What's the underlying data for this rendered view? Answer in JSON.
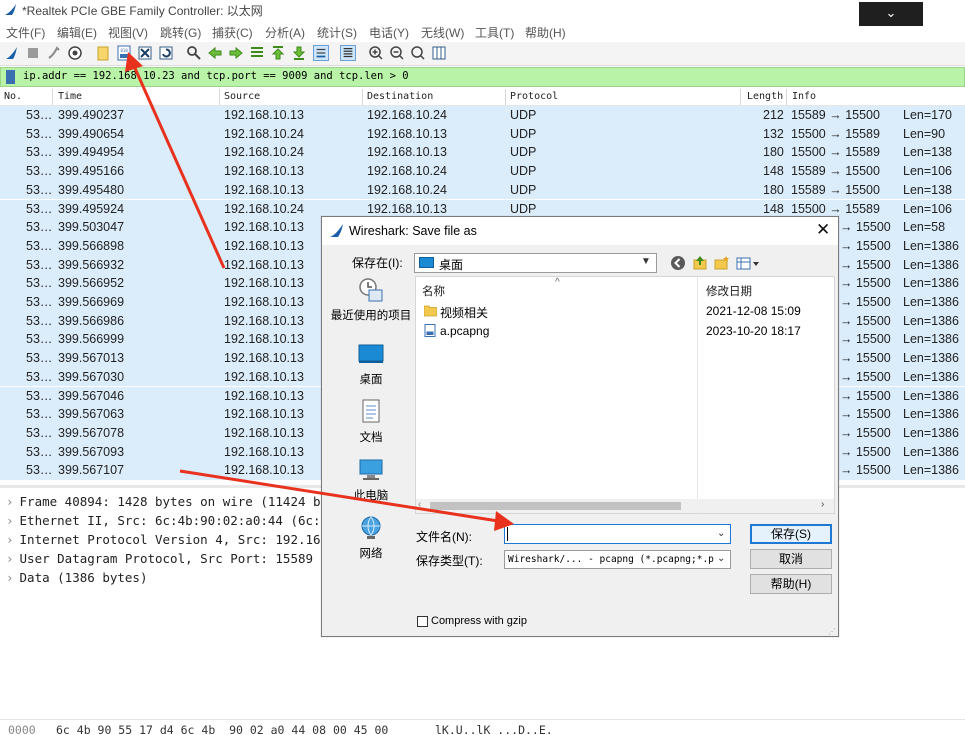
{
  "window": {
    "title": "*Realtek PCIe GBE Family Controller: 以太网",
    "minimize_glyph": "⌄"
  },
  "menu": [
    "文件(F)",
    "编辑(E)",
    "视图(V)",
    "跳转(G)",
    "捕获(C)",
    "分析(A)",
    "统计(S)",
    "电话(Y)",
    "无线(W)",
    "工具(T)",
    "帮助(H)"
  ],
  "toolbar": {
    "icons": [
      "shark-fin-start-icon",
      "stop-capture-icon",
      "restart-capture-icon",
      "capture-options-icon",
      "open-file-icon",
      "save-file-icon",
      "close-file-icon",
      "reload-file-icon",
      "find-packet-icon",
      "go-back-icon",
      "go-forward-icon",
      "go-to-packet-icon",
      "go-first-icon",
      "go-last-icon",
      "auto-scroll-icon",
      "colorize-icon",
      "zoom-in-icon",
      "zoom-out-icon",
      "zoom-normal-icon",
      "resize-columns-icon"
    ]
  },
  "filter": {
    "text": "ip.addr == 192.168.10.23 and tcp.port == 9009 and tcp.len > 0"
  },
  "columns": [
    "No.",
    "Time",
    "Source",
    "Destination",
    "Protocol",
    "Length",
    "Info"
  ],
  "packets": [
    {
      "no": "53…",
      "time": "399.490237",
      "src": "192.168.10.13",
      "dst": "192.168.10.24",
      "proto": "UDP",
      "len": "212",
      "info": "15589 → 15500",
      "extra": "Len=170"
    },
    {
      "no": "53…",
      "time": "399.490654",
      "src": "192.168.10.24",
      "dst": "192.168.10.13",
      "proto": "UDP",
      "len": "132",
      "info": "15500 → 15589",
      "extra": "Len=90"
    },
    {
      "no": "53…",
      "time": "399.494954",
      "src": "192.168.10.24",
      "dst": "192.168.10.13",
      "proto": "UDP",
      "len": "180",
      "info": "15500 → 15589",
      "extra": "Len=138"
    },
    {
      "no": "53…",
      "time": "399.495166",
      "src": "192.168.10.13",
      "dst": "192.168.10.24",
      "proto": "UDP",
      "len": "148",
      "info": "15589 → 15500",
      "extra": "Len=106"
    },
    {
      "no": "53…",
      "time": "399.495480",
      "src": "192.168.10.13",
      "dst": "192.168.10.24",
      "proto": "UDP",
      "len": "180",
      "info": "15589 → 15500",
      "extra": "Len=138"
    },
    {
      "no": "53…",
      "time": "399.495924",
      "src": "192.168.10.24",
      "dst": "192.168.10.13",
      "proto": "UDP",
      "len": "148",
      "info": "15500 → 15589",
      "extra": "Len=106"
    },
    {
      "no": "53…",
      "time": "399.503047",
      "src": "192.168.10.13",
      "dst": "",
      "proto": "",
      "len": "",
      "info": "→ 15500",
      "extra": "Len=58"
    },
    {
      "no": "53…",
      "time": "399.566898",
      "src": "192.168.10.13",
      "dst": "",
      "proto": "",
      "len": "",
      "info": "→ 15500",
      "extra": "Len=1386"
    },
    {
      "no": "53…",
      "time": "399.566932",
      "src": "192.168.10.13",
      "dst": "",
      "proto": "",
      "len": "",
      "info": "→ 15500",
      "extra": "Len=1386"
    },
    {
      "no": "53…",
      "time": "399.566952",
      "src": "192.168.10.13",
      "dst": "",
      "proto": "",
      "len": "",
      "info": "→ 15500",
      "extra": "Len=1386"
    },
    {
      "no": "53…",
      "time": "399.566969",
      "src": "192.168.10.13",
      "dst": "",
      "proto": "",
      "len": "",
      "info": "→ 15500",
      "extra": "Len=1386"
    },
    {
      "no": "53…",
      "time": "399.566986",
      "src": "192.168.10.13",
      "dst": "",
      "proto": "",
      "len": "",
      "info": "→ 15500",
      "extra": "Len=1386"
    },
    {
      "no": "53…",
      "time": "399.566999",
      "src": "192.168.10.13",
      "dst": "",
      "proto": "",
      "len": "",
      "info": "→ 15500",
      "extra": "Len=1386"
    },
    {
      "no": "53…",
      "time": "399.567013",
      "src": "192.168.10.13",
      "dst": "",
      "proto": "",
      "len": "",
      "info": "→ 15500",
      "extra": "Len=1386"
    },
    {
      "no": "53…",
      "time": "399.567030",
      "src": "192.168.10.13",
      "dst": "",
      "proto": "",
      "len": "",
      "info": "→ 15500",
      "extra": "Len=1386"
    },
    {
      "no": "53…",
      "time": "399.567046",
      "src": "192.168.10.13",
      "dst": "",
      "proto": "",
      "len": "",
      "info": "→ 15500",
      "extra": "Len=1386"
    },
    {
      "no": "53…",
      "time": "399.567063",
      "src": "192.168.10.13",
      "dst": "",
      "proto": "",
      "len": "",
      "info": "→ 15500",
      "extra": "Len=1386"
    },
    {
      "no": "53…",
      "time": "399.567078",
      "src": "192.168.10.13",
      "dst": "",
      "proto": "",
      "len": "",
      "info": "→ 15500",
      "extra": "Len=1386"
    },
    {
      "no": "53…",
      "time": "399.567093",
      "src": "192.168.10.13",
      "dst": "",
      "proto": "",
      "len": "",
      "info": "→ 15500",
      "extra": "Len=1386"
    },
    {
      "no": "53…",
      "time": "399.567107",
      "src": "192.168.10.13",
      "dst": "",
      "proto": "",
      "len": "",
      "info": "→ 15500",
      "extra": "Len=1386"
    }
  ],
  "details": [
    "Frame 40894: 1428 bytes on wire (11424 bi",
    "Ethernet II, Src: 6c:4b:90:02:a0:44 (6c:4",
    "Internet Protocol Version 4, Src: 192.168",
    "User Datagram Protocol, Src Port: 15589",
    "Data (1386 bytes)"
  ],
  "hex": {
    "offset": "0000",
    "bytes": "6c 4b 90 55 17 d4 6c 4b  90 02 a0 44 08 00 45 00",
    "ascii": "lK.U..lK ...D..E."
  },
  "dialog": {
    "title": "Wireshark: Save file as",
    "close_glyph": "✕",
    "save_in_label": "保存在(I):",
    "save_in_value": "桌面",
    "places": [
      "最近使用的项目",
      "桌面",
      "文档",
      "此电脑",
      "网络"
    ],
    "columns": [
      "名称",
      "修改日期"
    ],
    "files": [
      {
        "name": "视频相关",
        "date": "2021-12-08 15:09",
        "icon": "folder-icon"
      },
      {
        "name": "a.pcapng",
        "date": "2023-10-20 18:17",
        "icon": "pcap-file-icon"
      }
    ],
    "filename_label": "文件名(N):",
    "filename_value": "",
    "filetype_label": "保存类型(T):",
    "filetype_value": "Wireshark/... - pcapng (*.pcapng;*.pc",
    "buttons": {
      "save": "保存(S)",
      "cancel": "取消",
      "help": "帮助(H)"
    },
    "gzip_label": "Compress with gzip",
    "gzip_checked": false
  },
  "colors": {
    "row_bg": "#dbecfa",
    "filter_bg": "#b9f3a8",
    "annotation_arrow": "#e8321e",
    "accent": "#1e78d4"
  }
}
